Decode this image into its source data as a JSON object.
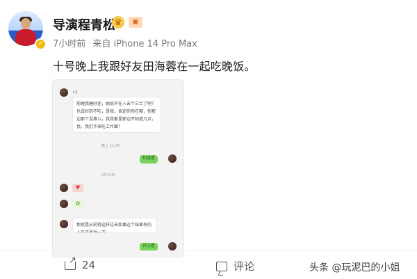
{
  "header": {
    "username": "导演程青松",
    "meta_time": "7小时前",
    "meta_source": "来自 iPhone 14 Pro Max"
  },
  "post": {
    "text": "十号晚上我跟好友田海蓉在一起吃晚饭。"
  },
  "attachment": {
    "chat_name": "•ʕ",
    "message_1": "前晚我睡好还，她说不在人去个三亡了吧？也说好的不吃，是我，肯定你你在哪，你那边那个没事么，我我那里那边不知道几点，我，我们不来吃工作面？",
    "time_1": "晚上 11:24",
    "reply_1": "知道看",
    "time_2": "2月12日",
    "message_2": "那就是从前就这样过去如果这个结果有的人在这里发一下",
    "reply_2": "开心看"
  },
  "footer": {
    "share_count": "24",
    "comment_label": "评论",
    "watermark": "头条 @玩泥巴的小姐"
  },
  "icons": {
    "avatar": "profile-avatar",
    "verified": "verified-badge",
    "share": "share-icon",
    "comment": "comment-icon"
  }
}
